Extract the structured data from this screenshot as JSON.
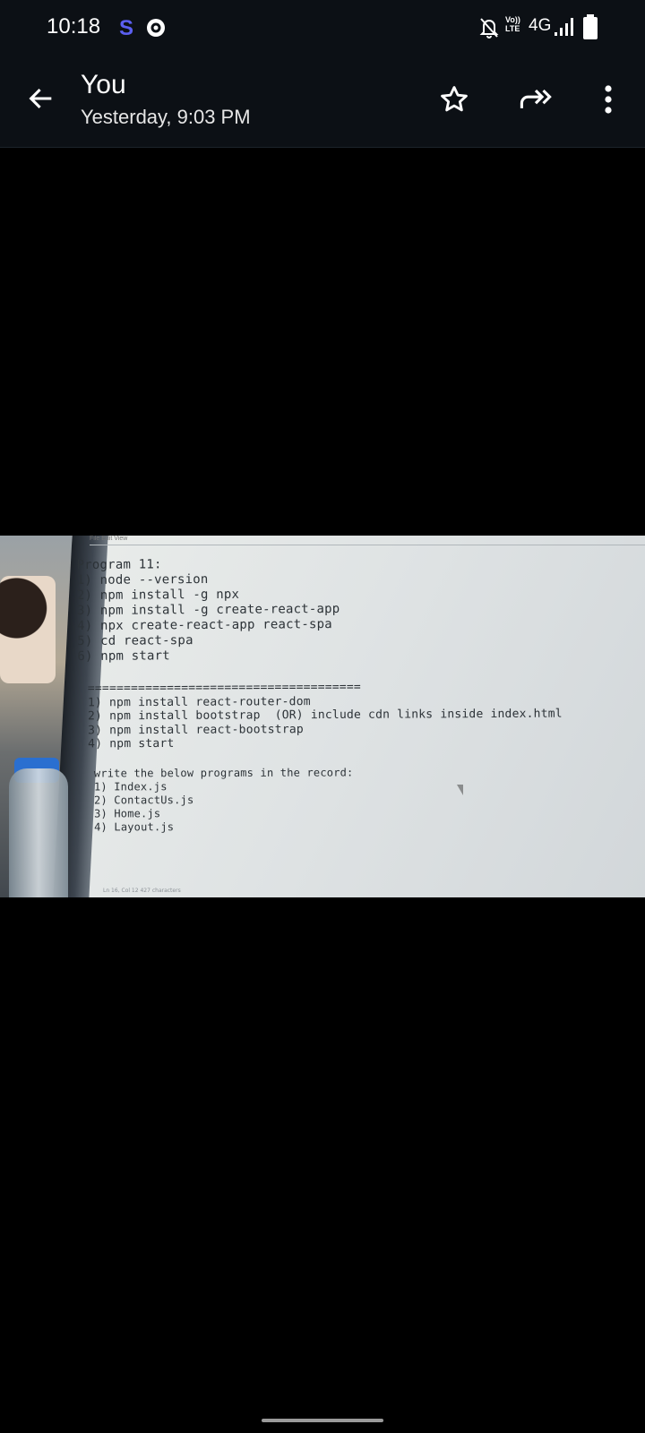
{
  "status_bar": {
    "time": "10:18",
    "network": "4G",
    "volte": "Vo))\nLTE"
  },
  "header": {
    "title": "You",
    "subtitle": "Yesterday, 9:03 PM"
  },
  "image": {
    "menu_strip": "File    Edit    View",
    "block1": "Program 11:\n1) node --version\n2) npm install -g npx\n3) npm install -g create-react-app\n4) npx create-react-app react-spa\n5) cd react-spa\n6) npm start",
    "block2": "======================================\n1) npm install react-router-dom\n2) npm install bootstrap  (OR) include cdn links inside index.html\n3) npm install react-bootstrap\n4) npm start",
    "block3": "write the below programs in the record:\n1) Index.js\n2) ContactUs.js\n3) Home.js\n4) Layout.js",
    "status_line": "Ln 16, Col 12    427 characters"
  },
  "colors": {
    "bar_bg": "#0c1015",
    "accent_s": "#5b5ff0"
  }
}
